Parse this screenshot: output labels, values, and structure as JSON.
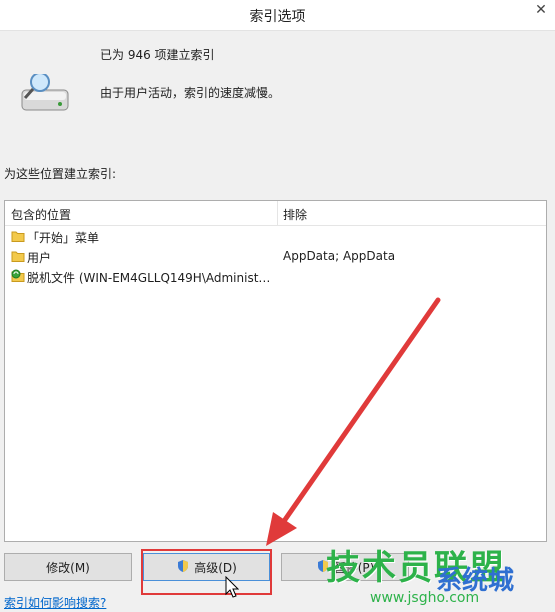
{
  "window": {
    "title": "索引选项",
    "close_glyph": "✕"
  },
  "status": {
    "indexed_count": "已为 946 项建立索引",
    "indexing_state": "由于用户活动，索引的速度减慢。"
  },
  "locations": {
    "section_label": "为这些位置建立索引:",
    "columns": {
      "included": "包含的位置",
      "excluded": "排除"
    },
    "rows": [
      {
        "icon": "folder-icon",
        "included": "「开始」菜单",
        "excluded": ""
      },
      {
        "icon": "folder-icon",
        "included": "用户",
        "excluded": "AppData; AppData"
      },
      {
        "icon": "sync-folder-icon",
        "included": "脱机文件 (WIN-EM4GLLQ149H\\Administr...",
        "excluded": ""
      }
    ]
  },
  "buttons": {
    "modify": "修改(M)",
    "advanced": "高级(D)",
    "pause": "暂停(P)"
  },
  "help_link": "索引如何影响搜索?",
  "watermark": {
    "main": "技术员联盟",
    "sub": "系统城",
    "url": "www.jsgho.com"
  },
  "colors": {
    "annotation_red": "#e03a3a",
    "link_blue": "#0066cc",
    "watermark_green": "#2db24a"
  }
}
